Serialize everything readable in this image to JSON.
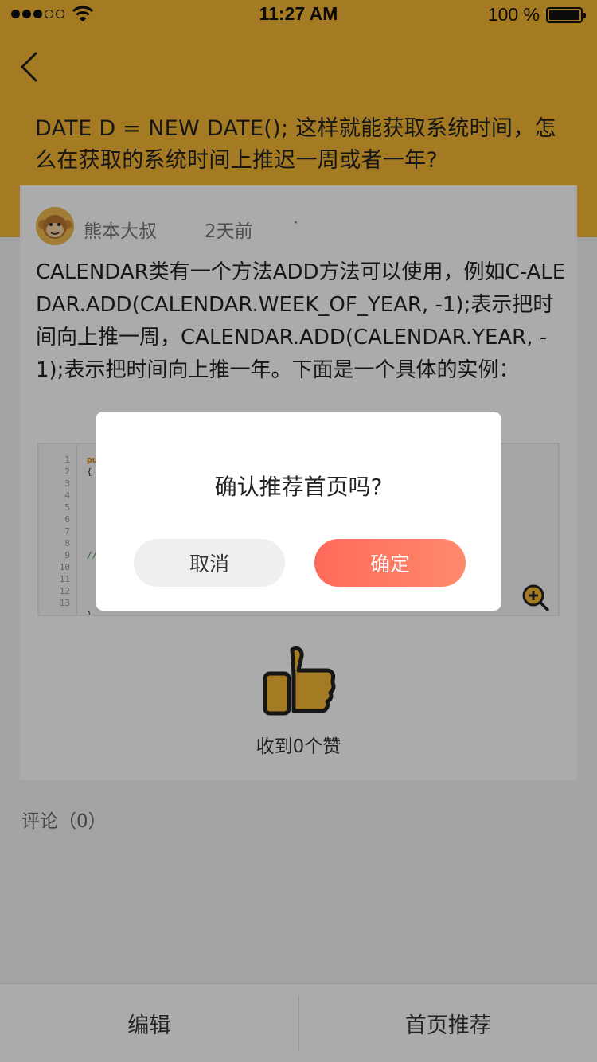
{
  "status_bar": {
    "time": "11:27 AM",
    "battery_text": "100 %",
    "signal_bars_filled": 3,
    "signal_bars_total": 5,
    "icons": [
      "signal-icon",
      "wifi-icon",
      "battery-icon"
    ]
  },
  "header": {
    "back_icon": "chevron-left-icon",
    "question": "DATE D = NEW DATE(); 这样就能获取系统时间，怎么在获取的系统时间上推迟一周或者一年?"
  },
  "answer": {
    "author": "熊本大叔",
    "time_ago": "2天前",
    "more": "·",
    "body": "CALENDAR类有一个方法ADD方法可以使用，例如C-ALEDAR.ADD(CALENDAR.WEEK_OF_YEAR, -1);表示把时间向上推一周，CALENDAR.ADD(CALENDAR.YEAR, -1);表示把时间向上推一年。下面是一个具体的实例：",
    "code_line_numbers": [
      "1",
      "2",
      "3",
      "4",
      "5",
      "6",
      "7",
      "8",
      "9",
      "10",
      "11",
      "12",
      "13"
    ],
    "likes_label": "收到0个赞"
  },
  "comments": {
    "label": "评论（0）"
  },
  "bottom_bar": {
    "edit_label": "编辑",
    "recommend_label": "首页推荐"
  },
  "dialog": {
    "title": "确认推荐首页吗?",
    "cancel_label": "取消",
    "confirm_label": "确定"
  },
  "colors": {
    "header_bg": "#f5b833",
    "confirm_button": "#ff6f5e",
    "cancel_button": "#efefef",
    "thumb_fill": "#f5b833"
  }
}
